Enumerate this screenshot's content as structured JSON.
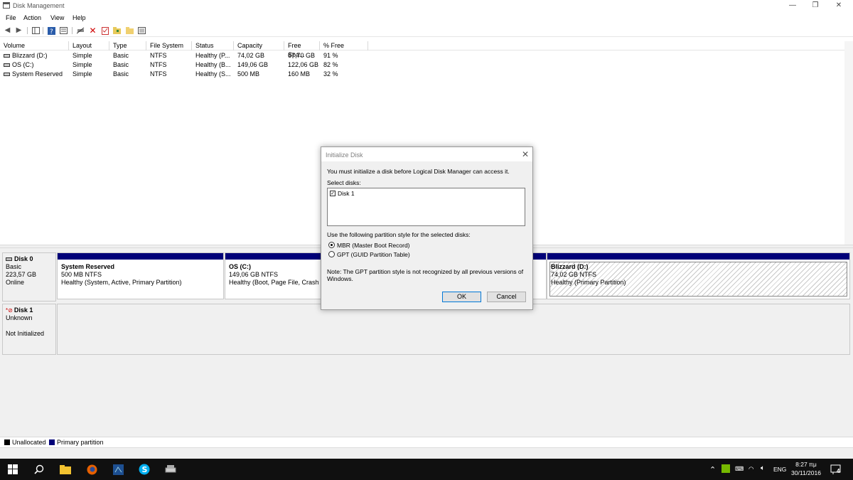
{
  "window": {
    "title": "Disk Management",
    "minimize": "—",
    "maximize": "❐",
    "close": "✕"
  },
  "menu": [
    "File",
    "Action",
    "View",
    "Help"
  ],
  "toolbar": {
    "icons": [
      "back-arrow-icon",
      "forward-arrow-icon",
      "console-tree-icon",
      "help-icon",
      "properties-icon",
      "connect-icon",
      "delete-icon",
      "checklist-icon",
      "folder-icon",
      "open-folder-icon",
      "details-icon"
    ]
  },
  "volume_table": {
    "columns": [
      "Volume",
      "Layout",
      "Type",
      "File System",
      "Status",
      "Capacity",
      "Free Spa...",
      "% Free"
    ],
    "rows": [
      {
        "volume": "Blizzard (D:)",
        "layout": "Simple",
        "type": "Basic",
        "fs": "NTFS",
        "status": "Healthy (P...",
        "capacity": "74,02 GB",
        "free": "67,70 GB",
        "pct": "91 %"
      },
      {
        "volume": "OS (C:)",
        "layout": "Simple",
        "type": "Basic",
        "fs": "NTFS",
        "status": "Healthy (B...",
        "capacity": "149,06 GB",
        "free": "122,06 GB",
        "pct": "82 %"
      },
      {
        "volume": "System Reserved",
        "layout": "Simple",
        "type": "Basic",
        "fs": "NTFS",
        "status": "Healthy (S...",
        "capacity": "500 MB",
        "free": "160 MB",
        "pct": "32 %"
      }
    ]
  },
  "disks": {
    "disk0": {
      "name": "Disk 0",
      "type": "Basic",
      "size": "223,57 GB",
      "state": "Online",
      "partitions": [
        {
          "name": "System Reserved",
          "size": "500 MB NTFS",
          "status": "Healthy (System, Active, Primary Partition)"
        },
        {
          "name": "OS  (C:)",
          "size": "149,06 GB NTFS",
          "status": "Healthy (Boot, Page File, Crash D"
        },
        {
          "name": "Blizzard  (D:)",
          "size": "74,02 GB NTFS",
          "status": "Healthy (Primary Partition)"
        }
      ]
    },
    "disk1": {
      "name": "Disk 1",
      "type": "Unknown",
      "state": "Not Initialized"
    }
  },
  "legend": [
    {
      "label": "Unallocated",
      "color": "#000000"
    },
    {
      "label": "Primary partition",
      "color": "#000078"
    }
  ],
  "dialog": {
    "title": "Initialize Disk",
    "intro": "You must initialize a disk before Logical Disk Manager can access it.",
    "select_label": "Select disks:",
    "disk_item": "Disk 1",
    "disk_checked": true,
    "style_label": "Use the following partition style for the selected disks:",
    "option_mbr": "MBR (Master Boot Record)",
    "option_gpt": "GPT (GUID Partition Table)",
    "selected_style": "MBR",
    "note_line1": "Note: The GPT partition style is not recognized by all previous versions of",
    "note_line2": "Windows.",
    "ok": "OK",
    "cancel": "Cancel"
  },
  "taskbar": {
    "icons": [
      "windows-start-icon",
      "search-icon",
      "file-explorer-icon",
      "firefox-icon",
      "app-icon",
      "skype-icon",
      "disk-management-icon"
    ],
    "lang": "ENG",
    "time": "8:27 πμ",
    "date": "30/11/2016",
    "notifications": "4"
  },
  "colors": {
    "primary_partition": "#000078",
    "accent": "#0078d7"
  }
}
